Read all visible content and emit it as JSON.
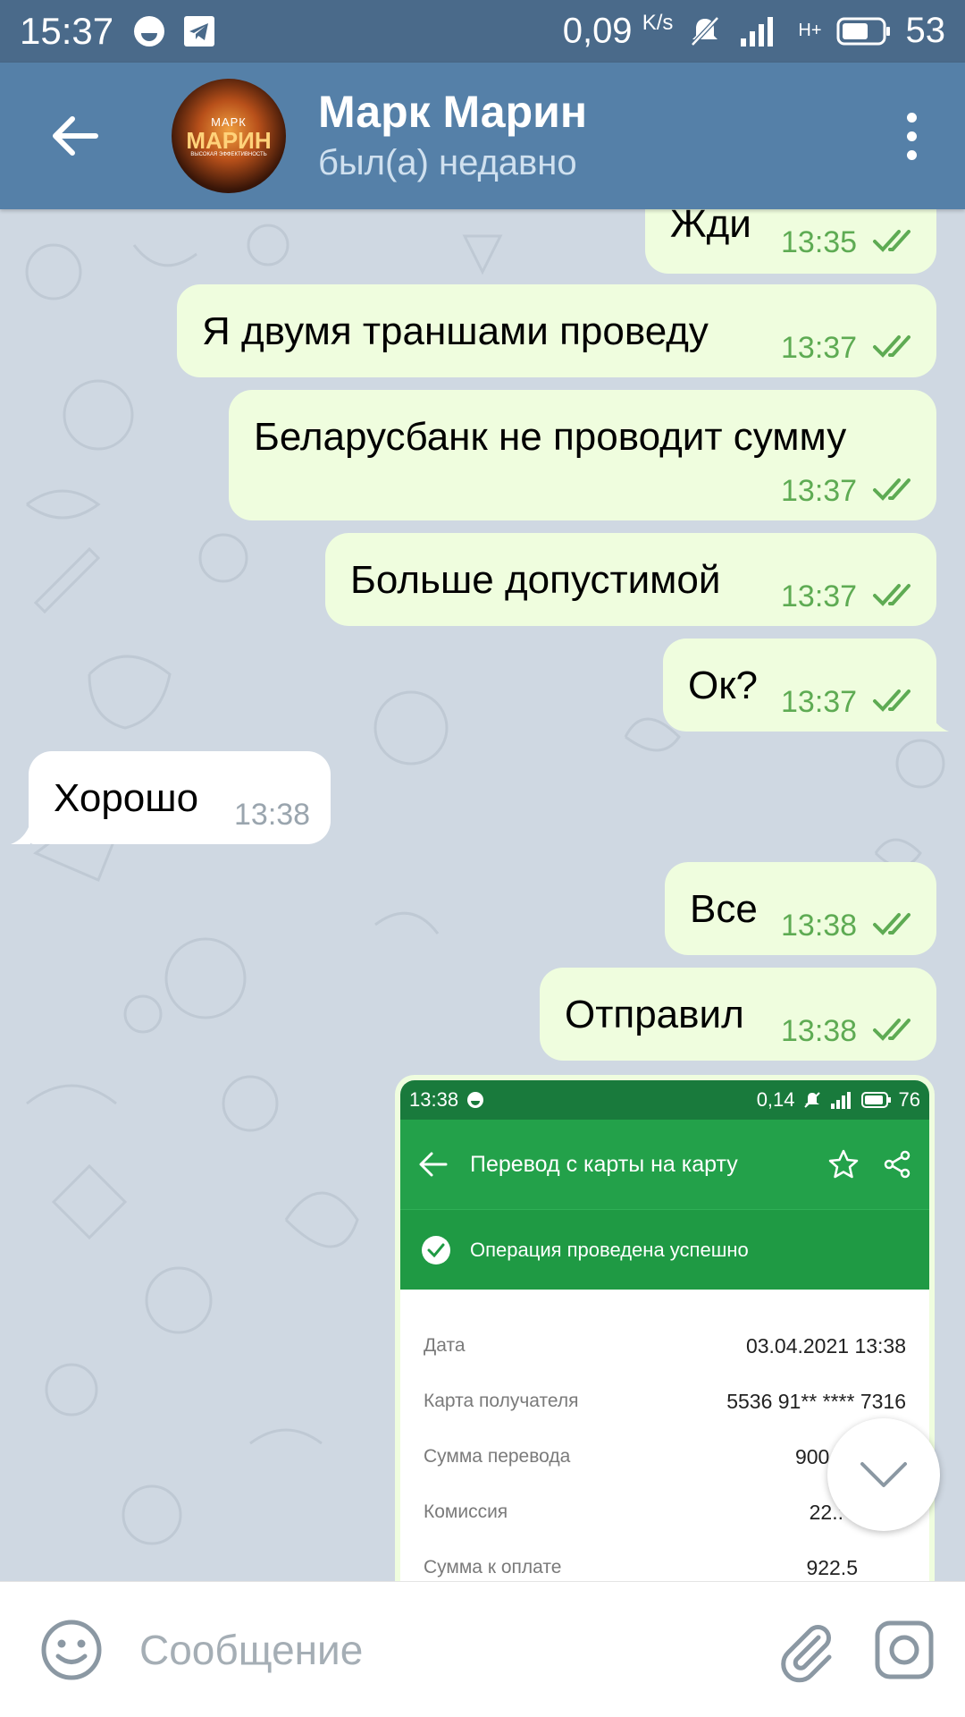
{
  "status_bar": {
    "time": "15:37",
    "net_speed": "0,09",
    "net_unit": "K/s",
    "network": "H+",
    "battery": "53"
  },
  "header": {
    "contact_name": "Марк Марин",
    "last_seen": "был(а) недавно",
    "avatar": {
      "line1": "МАРК",
      "line2": "МАРИН",
      "line3": "ВЫСОКАЯ ЭФФЕКТИВНОСТЬ"
    }
  },
  "messages": [
    {
      "direction": "out",
      "text": "Жди",
      "time": "13:35",
      "read": true
    },
    {
      "direction": "out",
      "text": "Я двумя траншами проведу",
      "time": "13:37",
      "read": true
    },
    {
      "direction": "out",
      "text": "Беларусбанк не проводит сумму",
      "time": "13:37",
      "read": true
    },
    {
      "direction": "out",
      "text": "Больше допустимой",
      "time": "13:37",
      "read": true
    },
    {
      "direction": "out",
      "text": "Ок?",
      "time": "13:37",
      "read": true
    },
    {
      "direction": "in",
      "text": "Хорошо",
      "time": "13:38"
    },
    {
      "direction": "out",
      "text": "Все",
      "time": "13:38",
      "read": true
    },
    {
      "direction": "out",
      "text": "Отправил",
      "time": "13:38",
      "read": true
    }
  ],
  "receipt": {
    "status_time": "13:38",
    "status_speed": "0,14",
    "status_battery": "76",
    "title": "Перевод с карты на карту",
    "success": "Операция проведена успешно",
    "rows": [
      {
        "label": "Дата",
        "value": "03.04.2021 13:38"
      },
      {
        "label": "Карта получателя",
        "value": "5536 91** **** 7316"
      },
      {
        "label": "Сумма перевода",
        "value": "900.00 BYN"
      },
      {
        "label": "Комиссия",
        "value": "22.:"
      },
      {
        "label": "Сумма к оплате",
        "value": "922.5"
      }
    ]
  },
  "input": {
    "placeholder": "Сообщение"
  },
  "colors": {
    "header": "#5580a8",
    "status_bar": "#4a6a8a",
    "outgoing_bubble": "#effdde",
    "time_green": "#5eab53",
    "receipt_green": "#23a14a"
  }
}
